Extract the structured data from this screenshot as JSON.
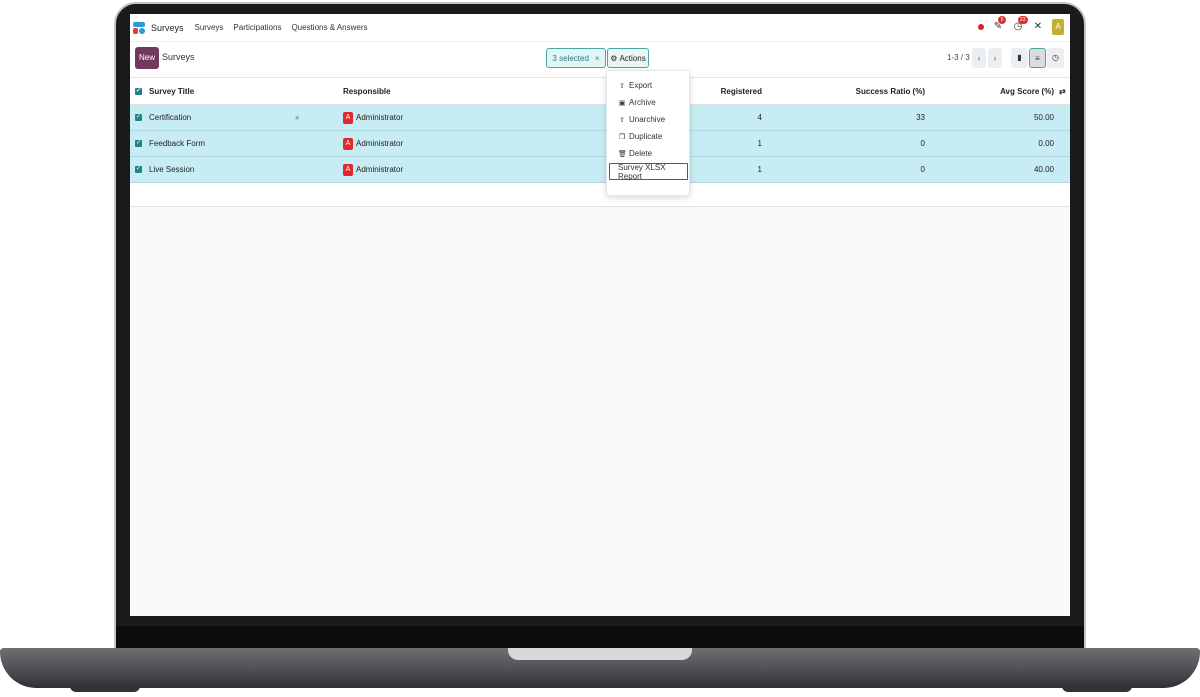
{
  "app": {
    "name": "Surveys"
  },
  "menu": [
    "Surveys",
    "Participations",
    "Questions & Answers"
  ],
  "systray": {
    "messages_badge": "5",
    "activity_badge": "23",
    "user_initial": "A"
  },
  "control_panel": {
    "new_label": "New",
    "title": "Surveys",
    "selected_label": "3 selected",
    "clear_selection": "×",
    "actions_label": "Actions",
    "pager": "1-3 / 3"
  },
  "table": {
    "columns": [
      "Survey Title",
      "Responsible",
      "Registered",
      "Success Ratio (%)",
      "Avg Score (%)"
    ],
    "rows": [
      {
        "title": "Certification",
        "responsible": "Administrator",
        "avatar": "A",
        "registered": "4",
        "success_ratio": "33",
        "avg_score": "50.00"
      },
      {
        "title": "Feedback Form",
        "responsible": "Administrator",
        "avatar": "A",
        "registered": "1",
        "success_ratio": "0",
        "avg_score": "0.00"
      },
      {
        "title": "Live Session",
        "responsible": "Administrator",
        "avatar": "A",
        "registered": "1",
        "success_ratio": "0",
        "avg_score": "40.00"
      }
    ]
  },
  "actions_menu": [
    "Export",
    "Archive",
    "Unarchive",
    "Duplicate",
    "Delete",
    "Survey XLSX Report"
  ],
  "colors": {
    "brand": "#71395e",
    "accent": "#4aa5a5",
    "selected_row": "#c8ecf4",
    "highlight_border": "#d42424"
  }
}
